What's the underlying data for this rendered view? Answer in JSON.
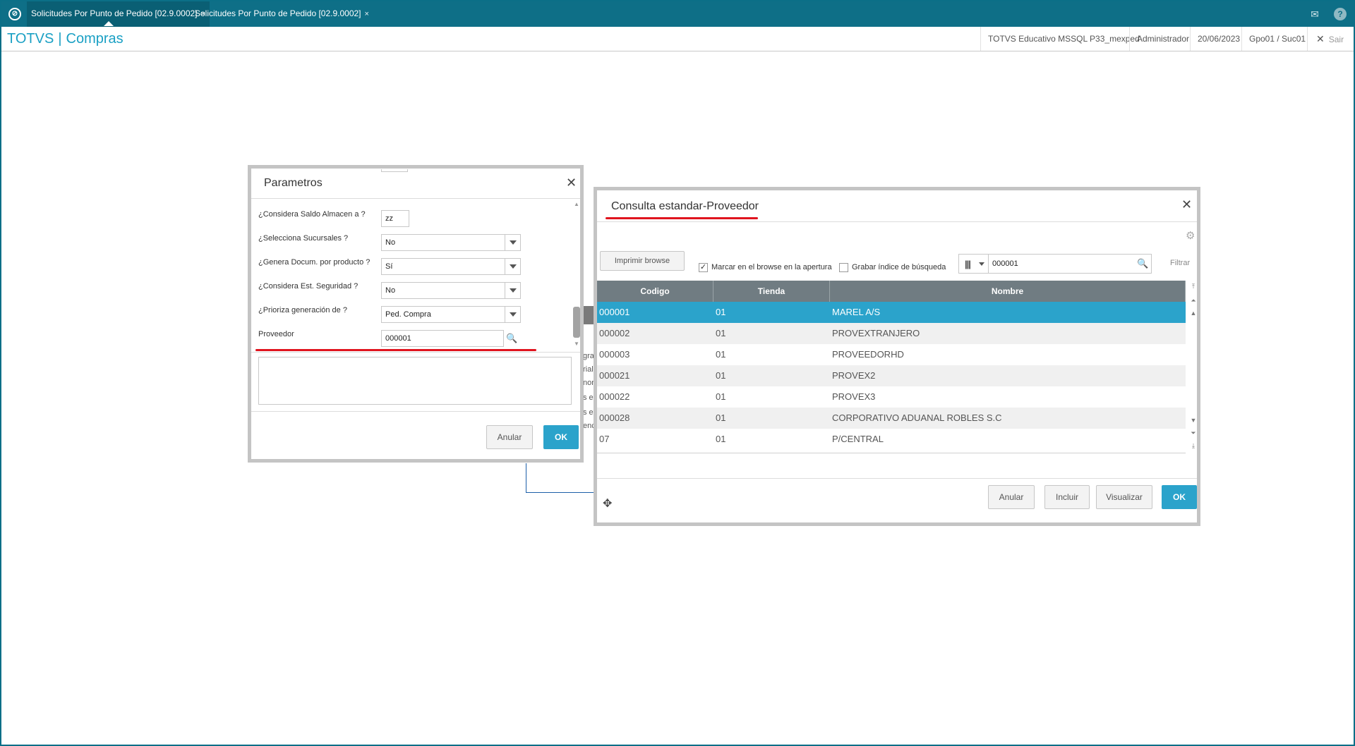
{
  "tabs": [
    {
      "label": "Solicitudes Por Punto de Pedido [02.9.0002]",
      "close": "×"
    },
    {
      "label": "Solicitudes Por Punto de Pedido [02.9.0002]",
      "close": "×"
    }
  ],
  "header": {
    "brand_left": "TOTVS",
    "brand_sep": "|",
    "brand_right": "Compras",
    "environment": "TOTVS Educativo MSSQL P33_mexped",
    "user": "Administrador",
    "date": "20/06/2023",
    "branch": "Gpo01 / Suc01",
    "logout": "Sair"
  },
  "background_fragments": [
    "gra",
    "rial",
    "non",
    "s er",
    "s e",
    "enc"
  ],
  "parametros": {
    "title": "Parametros",
    "fields": [
      {
        "label": "¿Considera Saldo Almacen a ?",
        "value": "zz"
      },
      {
        "label": "¿Selecciona Sucursales ?",
        "value": "No"
      },
      {
        "label": "¿Genera Docum. por producto ?",
        "value": "Sí"
      },
      {
        "label": "¿Considera Est. Seguridad ?",
        "value": "No"
      },
      {
        "label": "¿Prioriza generación de ?",
        "value": "Ped. Compra"
      },
      {
        "label": "Proveedor",
        "value": "000001"
      }
    ],
    "cancel_label": "Anular",
    "ok_label": "OK"
  },
  "consulta": {
    "title": "Consulta estandar-Proveedor",
    "print_label": "Imprimir browse",
    "mark_label": "Marcar en el browse en la apertura",
    "mark_checked": true,
    "save_index_label": "Grabar índice de búsqueda",
    "save_index_checked": false,
    "search_value": "000001",
    "filter_label": "Filtrar",
    "columns": [
      "Codigo",
      "Tienda",
      "Nombre"
    ],
    "rows": [
      {
        "codigo": "000001",
        "tienda": "01",
        "nombre": "MAREL A/S",
        "selected": true
      },
      {
        "codigo": "000002",
        "tienda": "01",
        "nombre": "PROVEXTRANJERO"
      },
      {
        "codigo": "000003",
        "tienda": "01",
        "nombre": "PROVEEDORHD"
      },
      {
        "codigo": "000021",
        "tienda": "01",
        "nombre": "PROVEX2"
      },
      {
        "codigo": "000022",
        "tienda": "01",
        "nombre": "PROVEX3"
      },
      {
        "codigo": "000028",
        "tienda": "01",
        "nombre": "CORPORATIVO ADUANAL ROBLES S.C"
      },
      {
        "codigo": "07",
        "tienda": "01",
        "nombre": "P/CENTRAL"
      }
    ],
    "buttons": {
      "cancel": "Anular",
      "include": "Incluir",
      "view": "Visualizar",
      "ok": "OK"
    }
  },
  "colors": {
    "topbar": "#0e6f87",
    "accent": "#2ba3cb",
    "underline": "#e0141e",
    "grid_header": "#707c82"
  }
}
